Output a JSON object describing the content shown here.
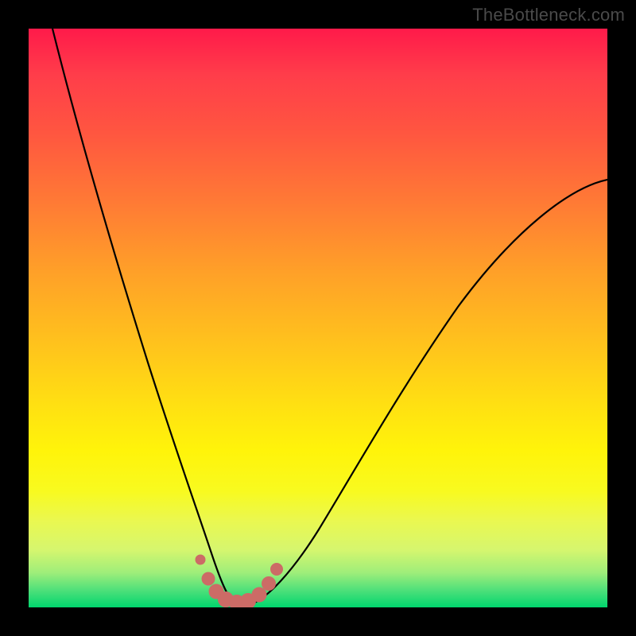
{
  "watermark": "TheBottleneck.com",
  "chart_data": {
    "type": "line",
    "title": "",
    "xlabel": "",
    "ylabel": "",
    "xlim": [
      0,
      1
    ],
    "ylim": [
      0,
      1
    ],
    "grid": false,
    "legend": false,
    "series": [
      {
        "name": "bottleneck-curve",
        "stroke": "#000000",
        "x": [
          0.0,
          0.05,
          0.1,
          0.15,
          0.2,
          0.25,
          0.28,
          0.3,
          0.32,
          0.34,
          0.36,
          0.38,
          0.42,
          0.48,
          0.55,
          0.62,
          0.7,
          0.8,
          0.9,
          1.0
        ],
        "y": [
          1.0,
          0.86,
          0.72,
          0.58,
          0.44,
          0.28,
          0.15,
          0.06,
          0.01,
          0.0,
          0.0,
          0.02,
          0.09,
          0.22,
          0.36,
          0.48,
          0.58,
          0.67,
          0.72,
          0.74
        ]
      },
      {
        "name": "optimal-marker-dots",
        "stroke": "#cc6b66",
        "marker": "circle",
        "x": [
          0.28,
          0.295,
          0.308,
          0.325,
          0.345,
          0.365,
          0.38,
          0.395
        ],
        "y": [
          0.085,
          0.045,
          0.02,
          0.01,
          0.01,
          0.025,
          0.05,
          0.085
        ]
      }
    ],
    "gradient_stops": [
      {
        "pos": 0.0,
        "color": "#ff1a4a"
      },
      {
        "pos": 0.3,
        "color": "#ff7a35"
      },
      {
        "pos": 0.65,
        "color": "#ffe012"
      },
      {
        "pos": 0.9,
        "color": "#d6f66e"
      },
      {
        "pos": 1.0,
        "color": "#00d66e"
      }
    ]
  }
}
